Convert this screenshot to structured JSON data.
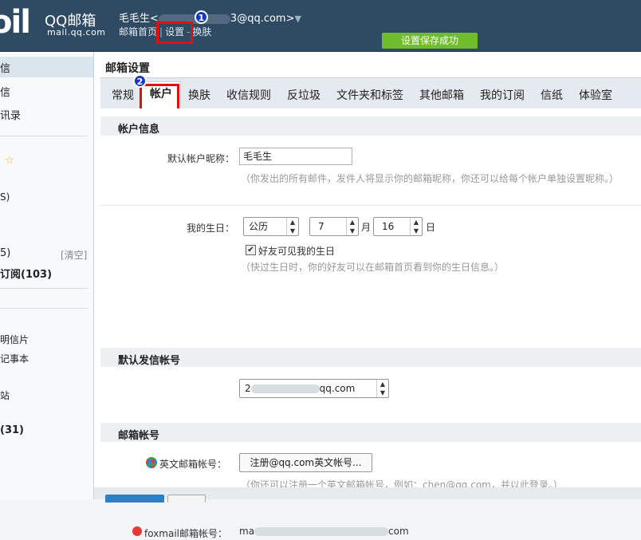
{
  "header": {
    "logo_mark": "oil",
    "logo_title": "QQ邮箱",
    "logo_sub": "mail.qq.com",
    "user_name": "毛毛生",
    "user_email_prefix": "<",
    "user_email_suffix": "3@qq.com>",
    "links": [
      "邮箱首页",
      "设置",
      "换肤"
    ],
    "badge1": "1",
    "save_message": "设置保存成功"
  },
  "sidebar": {
    "items": [
      "信",
      "信",
      "讯录",
      "☆",
      "S)",
      "5)",
      "订阅(103)",
      "明信片",
      "记事本",
      "站",
      "(31)"
    ],
    "clear": "[清空]"
  },
  "main": {
    "title": "邮箱设置",
    "badge2": "2",
    "tabs": [
      "常规",
      "帐户",
      "换肤",
      "收信规则",
      "反垃圾",
      "文件夹和标签",
      "其他邮箱",
      "我的订阅",
      "信纸",
      "体验室"
    ]
  },
  "account": {
    "section_title": "帐户信息",
    "nickname_label": "默认帐户昵称：",
    "nickname_value": "毛毛生",
    "nickname_hint": "（你发出的所有邮件，发件人将显示你的邮箱昵称，你还可以给每个帐户单独设置昵称。）",
    "birthday_label": "我的生日：",
    "calendar_value": "公历",
    "month_value": "7",
    "month_unit": "月",
    "day_value": "16",
    "day_unit": "日",
    "friends_visible": "好友可见我的生日",
    "birthday_hint": "（快过生日时，你的好友可以在邮箱首页看到你的生日信息。）"
  },
  "sender": {
    "section_title": "默认发信帐号",
    "value_prefix": "2",
    "value_suffix": "qq.com"
  },
  "mailbox": {
    "section_title": "邮箱帐号",
    "english_label": "英文邮箱帐号：",
    "english_button": "注册@qq.com英文帐号...",
    "english_hint": "（你还可以注册一个英文邮箱帐号，例如：chen@qq.com，并以此登录。）",
    "foxmail_label": "foxmail邮箱帐号：",
    "foxmail_prefix": "ma",
    "foxmail_suffix": "com"
  },
  "colors": {
    "header_bg": "#2f4a63",
    "success": "#6fbd2c",
    "highlight": "#e01010",
    "badge": "#1438c4"
  }
}
